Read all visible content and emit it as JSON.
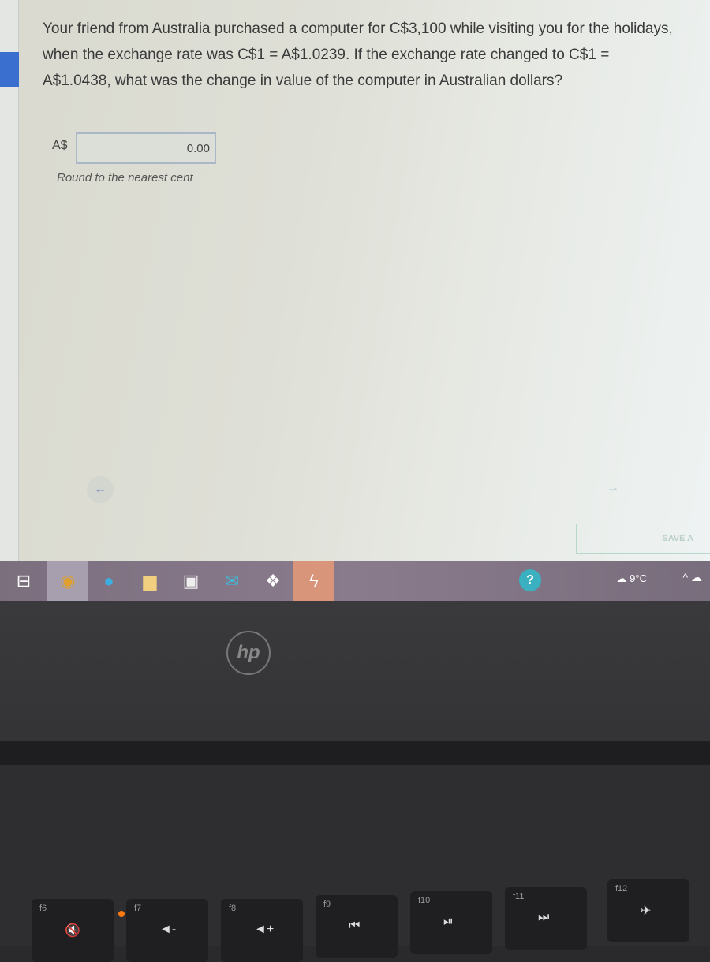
{
  "question": {
    "text": "Your friend from Australia purchased a computer for C$3,100 while visiting you for the holidays, when the exchange rate was C$1 = A$1.0239. If the exchange rate changed to C$1 = A$1.0438, what was the change in value of the computer in Australian dollars?"
  },
  "answer": {
    "currency_label": "A$",
    "value": "0.00",
    "hint": "Round to the nearest cent"
  },
  "nav": {
    "prev_icon": "‹",
    "next_icon": "›"
  },
  "save_button": {
    "label": "SAVE A"
  },
  "taskbar": {
    "apps": [
      "chrome",
      "edge",
      "file-explorer",
      "store",
      "mail",
      "dropbox",
      "lightning-app"
    ],
    "weather": "9°C",
    "tray_chevron": "^"
  },
  "laptop": {
    "brand": "hp"
  },
  "keyboard": {
    "keys": [
      {
        "fn": "f6",
        "icon": "🔇"
      },
      {
        "fn": "f7",
        "icon": "◄-"
      },
      {
        "fn": "f8",
        "icon": "◄+"
      },
      {
        "fn": "f9",
        "icon": "⏮"
      },
      {
        "fn": "f10",
        "icon": "⏯"
      },
      {
        "fn": "f11",
        "icon": "⏭"
      },
      {
        "fn": "f12",
        "icon": "✈"
      }
    ]
  },
  "colors": {
    "accent": "#3a6fd0",
    "taskbar": "#7b6f7e",
    "led": "#ff7a10"
  }
}
